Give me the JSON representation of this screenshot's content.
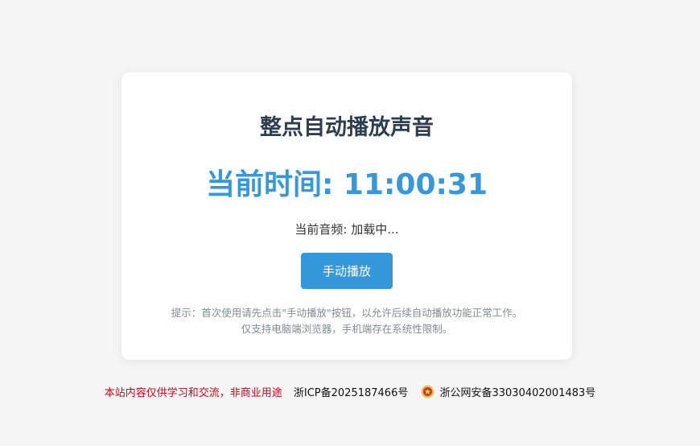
{
  "card": {
    "title": "整点自动播放声音",
    "clock_label": "当前时间: ",
    "clock_time": "11:00:31",
    "audio_label": "当前音频: ",
    "audio_value": "加载中...",
    "play_button_label": "手动播放",
    "hint_line1": "提示：首次使用请先点击\"手动播放\"按钮，以允许后续自动播放功能正常工作。",
    "hint_line2": "仅支持电脑端浏览器，手机端存在系统性限制。"
  },
  "footer": {
    "notice": "本站内容仅供学习和交流，非商业用途",
    "icp": "浙ICP备2025187466号",
    "police_record": "浙公网安备33030402001483号",
    "police_icon": "police-badge-icon"
  },
  "colors": {
    "background": "#f5f5f5",
    "title": "#2c3e50",
    "accent": "#3498db",
    "hint": "#7f8c8d",
    "notice": "#d0021b"
  }
}
